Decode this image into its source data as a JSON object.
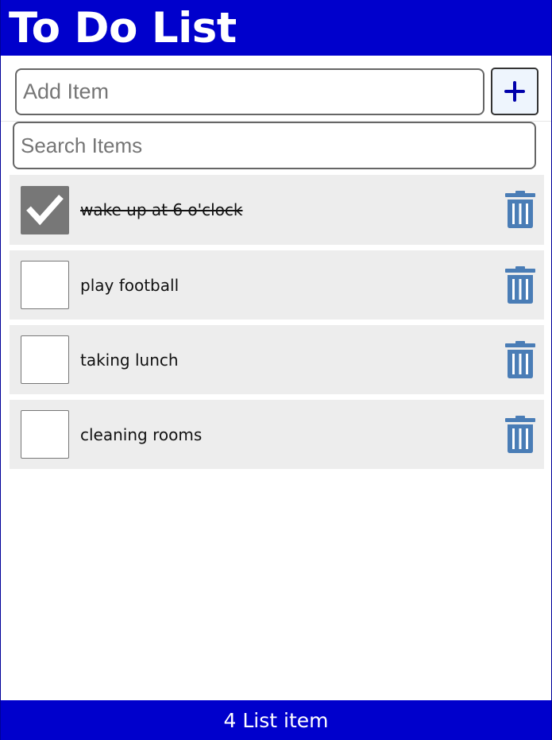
{
  "header": {
    "title": "To Do List"
  },
  "add_item": {
    "placeholder": "Add Item",
    "value": "",
    "button_icon": "plus-icon"
  },
  "search": {
    "placeholder": "Search Items",
    "value": ""
  },
  "items": [
    {
      "label": "wake up at 6 o'clock",
      "checked": true
    },
    {
      "label": "play football",
      "checked": false
    },
    {
      "label": "taking lunch",
      "checked": false
    },
    {
      "label": "cleaning rooms",
      "checked": false
    }
  ],
  "footer": {
    "count_text": "4 List item"
  },
  "colors": {
    "header_bg": "#0000cc",
    "footer_bg": "#0000cc",
    "trash_icon": "#4a7db6",
    "checked_bg": "#777777",
    "item_bg": "#ededed",
    "add_button_bg": "#eef5fd",
    "plus_icon": "#0000aa"
  }
}
